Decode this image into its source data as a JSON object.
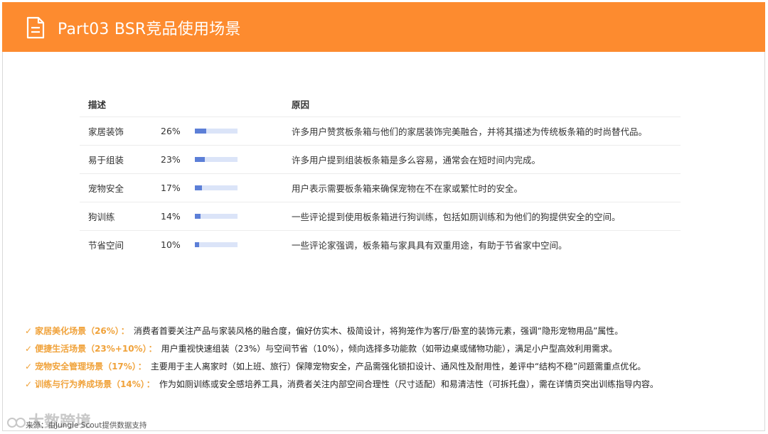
{
  "header": {
    "title": "Part03 BSR竞品使用场景",
    "icon": "document-icon",
    "bg_color": "#fd8b2f"
  },
  "table": {
    "col_desc": "描述",
    "col_reason": "原因",
    "rows": [
      {
        "label": "家居装饰",
        "percent": "26%",
        "fill": 0.26,
        "reason": "许多用户赞赏板条箱与他们的家居装饰完美融合，并将其描述为传统板条箱的时尚替代品。"
      },
      {
        "label": "易于组装",
        "percent": "23%",
        "fill": 0.23,
        "reason": "许多用户提到组装板条箱是多么容易，通常会在短时间内完成。"
      },
      {
        "label": "宠物安全",
        "percent": "17%",
        "fill": 0.17,
        "reason": "用户表示需要板条箱来确保宠物在不在家或繁忙时的安全。"
      },
      {
        "label": "狗训练",
        "percent": "14%",
        "fill": 0.14,
        "reason": "一些评论提到使用板条箱进行狗训练，包括如厕训练和为他们的狗提供安全的空间。"
      },
      {
        "label": "节省空间",
        "percent": "10%",
        "fill": 0.1,
        "reason": "一些评论家强调，板条箱与家具具有双重用途，有助于节省家中空间。"
      }
    ],
    "bar_color": "#5c7fd7",
    "track_color": "#dbe4f8"
  },
  "notes": [
    {
      "title": "家居美化场景（26%）",
      "text": "消费者首要关注产品与家装风格的融合度，偏好仿实木、极简设计，将狗笼作为客厅/卧室的装饰元素，强调“隐形宠物用品”属性。"
    },
    {
      "title": "便捷生活场景（23%+10%）",
      "text": "用户重视快速组装（23%）与空间节省（10%），倾向选择多功能款（如带边桌或储物功能），满足小户型高效利用需求。"
    },
    {
      "title": "宠物安全管理场景（17%）",
      "text": "主要用于主人离家时（如上班、旅行）保障宠物安全，产品需强化锁扣设计、通风性及耐用性，差评中“结构不稳”问题需重点优化。"
    },
    {
      "title": "训练与行为养成场景（14%）",
      "text": "作为如厕训练或安全感培养工具，消费者关注内部空间合理性（尺寸适配）和易清洁性（可拆托盘），需在详情页突出训练指导内容。"
    }
  ],
  "note_colon": "：",
  "note_check": "✓",
  "accent_color": "#f0a23a",
  "watermark": "大数跨境",
  "source": "来源：由Jungle Scout提供数据支持"
}
